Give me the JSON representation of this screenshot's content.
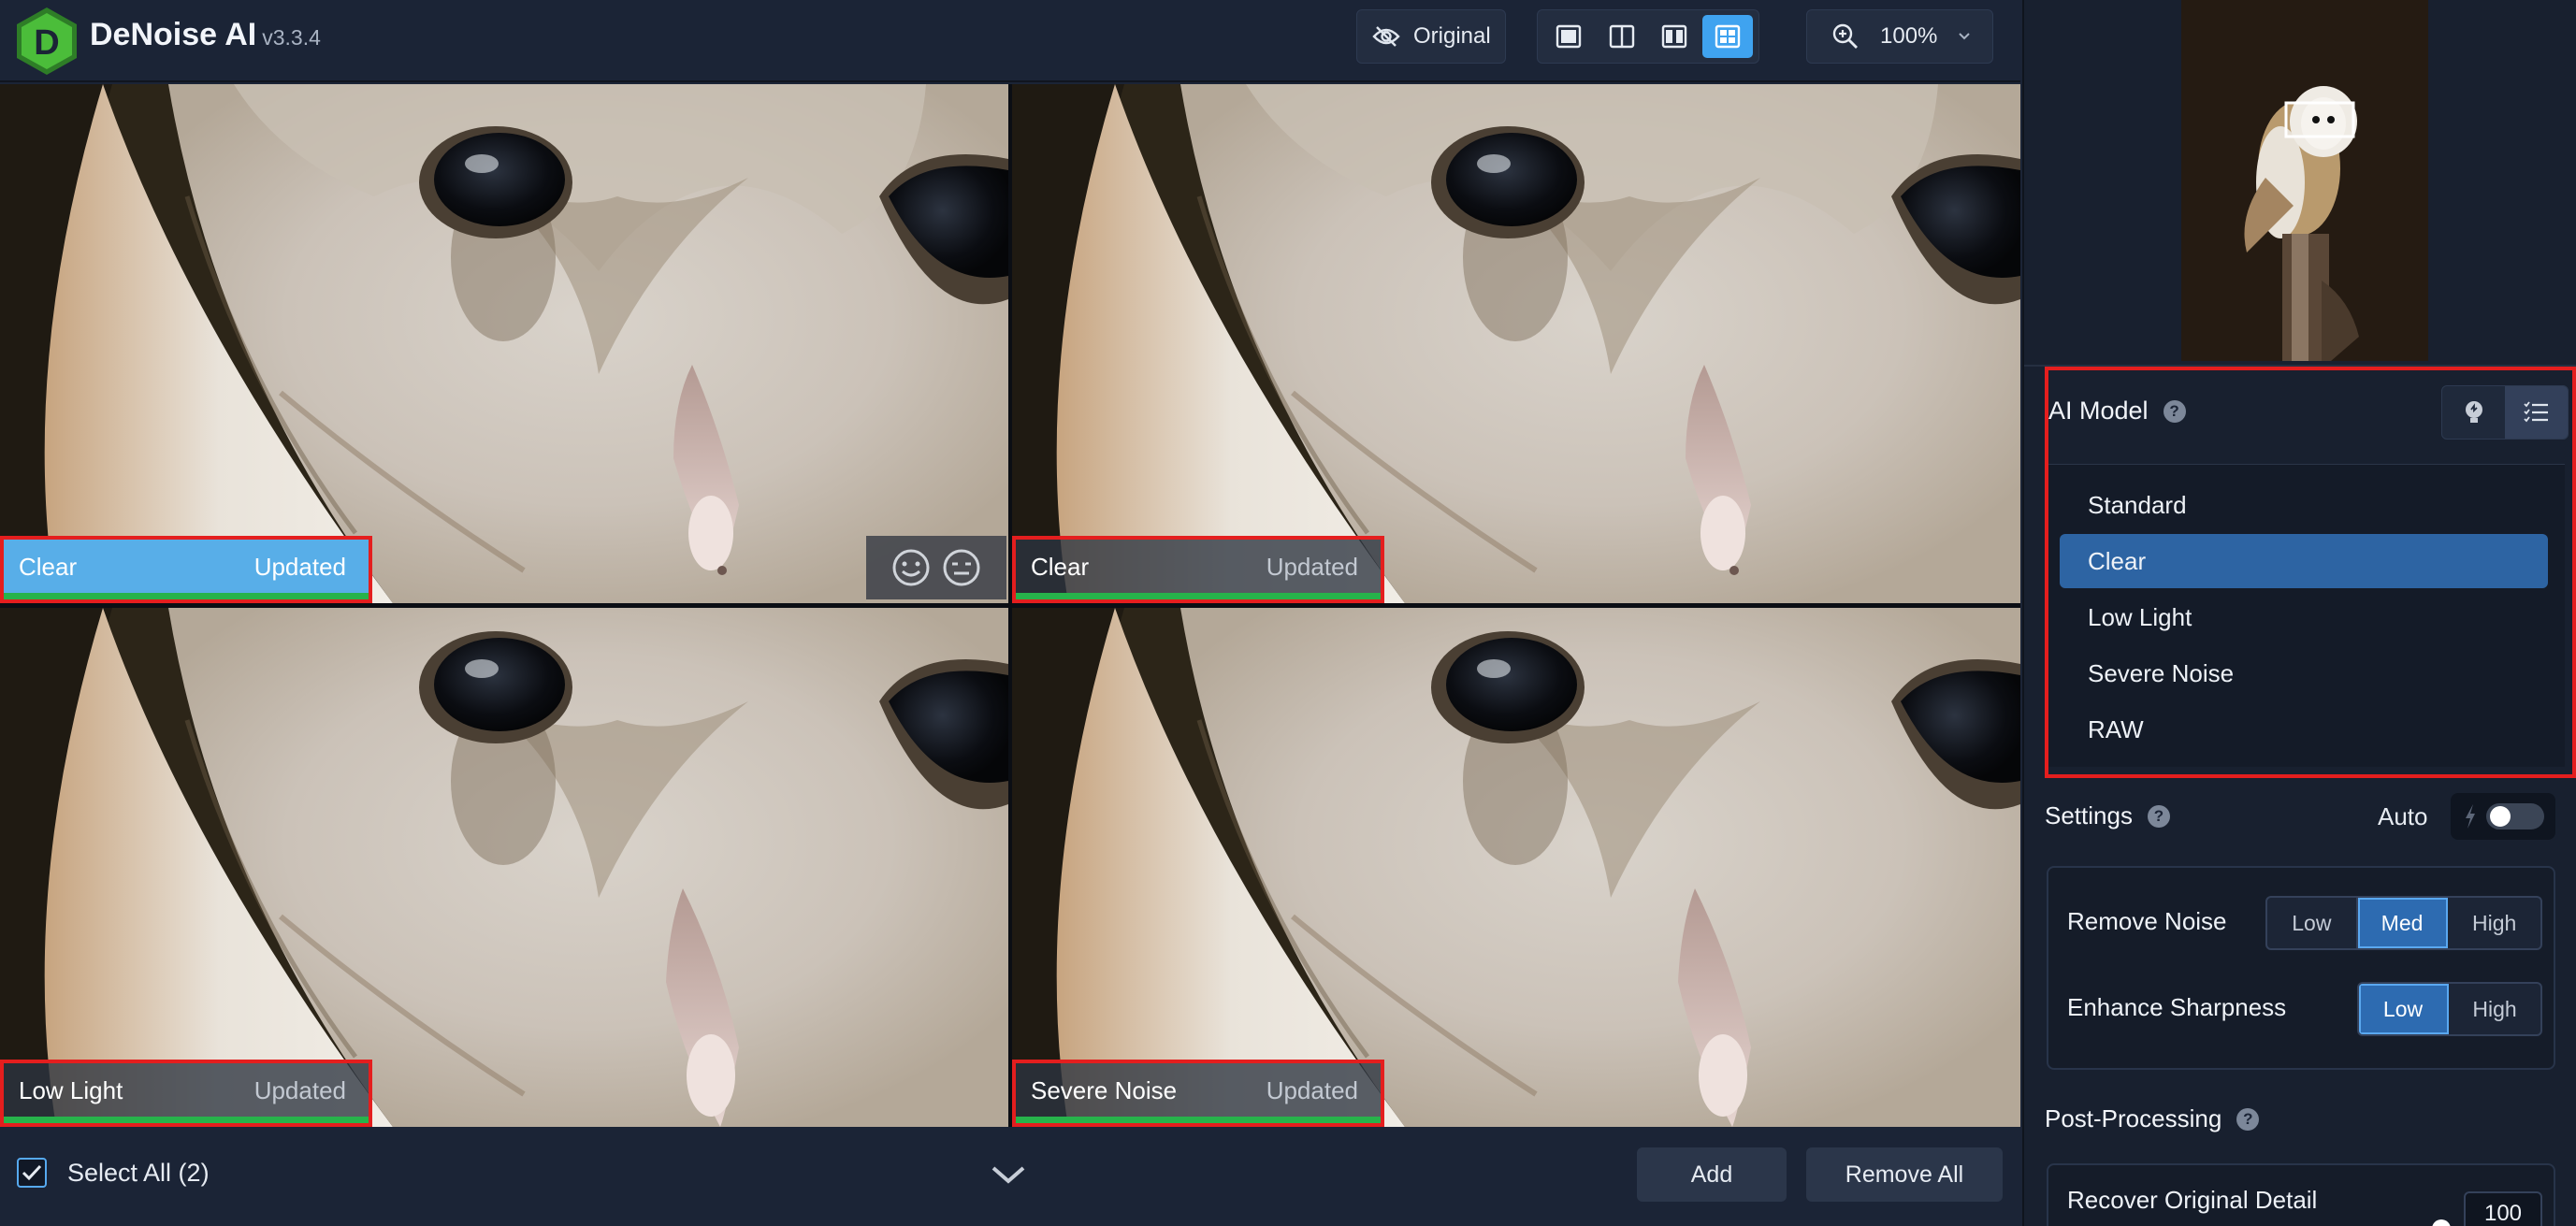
{
  "app": {
    "name": "DeNoise AI",
    "version": "v3.3.4",
    "logo_letter": "D",
    "accent_color": "#3fa3f0",
    "logo_color": "#4bbd3a"
  },
  "toolbar": {
    "original_label": "Original",
    "original_icon": "eye-off-icon",
    "view_modes": [
      {
        "name": "single-view",
        "icon": "single-view-icon",
        "active": false
      },
      {
        "name": "split-view",
        "icon": "split-view-icon",
        "active": false
      },
      {
        "name": "side-by-side-view",
        "icon": "side-by-side-view-icon",
        "active": false
      },
      {
        "name": "comparison-grid-view",
        "icon": "grid-view-icon",
        "active": true
      }
    ],
    "zoom_label": "100%",
    "zoom_icon": "zoom-in-icon"
  },
  "panes": [
    {
      "model": "Clear",
      "status": "Updated",
      "active": true
    },
    {
      "model": "Clear",
      "status": "Updated",
      "active": false
    },
    {
      "model": "Low Light",
      "status": "Updated",
      "active": false
    },
    {
      "model": "Severe Noise",
      "status": "Updated",
      "active": false
    }
  ],
  "rating_icons": [
    "smiley-happy-icon",
    "smiley-neutral-icon"
  ],
  "bottom": {
    "select_all_label": "Select All (2)",
    "select_all_checked": true,
    "add_label": "Add",
    "remove_all_label": "Remove All"
  },
  "ai_model": {
    "title": "AI Model",
    "help": "?",
    "mode_icons": [
      "lightbulb-icon",
      "list-icon"
    ],
    "models": [
      "Standard",
      "Clear",
      "Low Light",
      "Severe Noise",
      "RAW"
    ],
    "selected": "Clear"
  },
  "settings": {
    "title": "Settings",
    "help": "?",
    "auto_label": "Auto",
    "auto_enabled": false,
    "remove_noise": {
      "label": "Remove Noise",
      "options": [
        "Low",
        "Med",
        "High"
      ],
      "selected": "Med"
    },
    "enhance_sharpness": {
      "label": "Enhance Sharpness",
      "options": [
        "Low",
        "High"
      ],
      "selected": "Low"
    }
  },
  "post_processing": {
    "title": "Post-Processing",
    "help": "?",
    "recover_label": "Recover Original Detail",
    "recover_value": "100"
  }
}
